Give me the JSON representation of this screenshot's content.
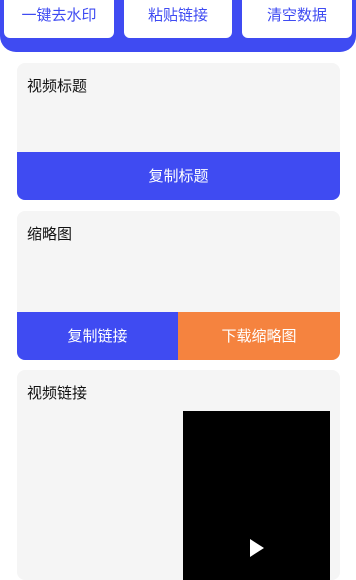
{
  "toolbar": {
    "remove_watermark": "一键去水印",
    "paste_link": "粘贴链接",
    "clear_data": "清空数据"
  },
  "video_title_card": {
    "label": "视频标题",
    "copy_button": "复制标题"
  },
  "thumbnail_card": {
    "label": "缩略图",
    "copy_link_button": "复制链接",
    "download_button": "下载缩略图"
  },
  "video_link_card": {
    "label": "视频链接"
  },
  "colors": {
    "primary": "#3f4bf2",
    "accent": "#f5833f",
    "card_bg": "#f5f5f5"
  },
  "icons": {
    "play": "play-icon"
  }
}
